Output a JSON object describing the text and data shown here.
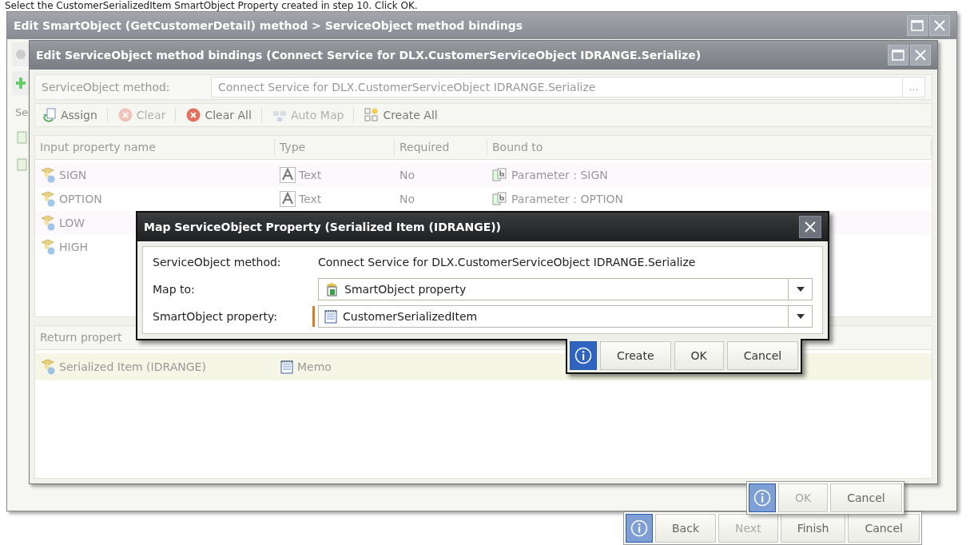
{
  "instruction": "Select the CustomerSerializedItem SmartObject Property created in step 10. Click OK.",
  "outer_window": {
    "title": "Edit SmartObject (GetCustomerDetail) method > ServiceObject method bindings",
    "side_label": "Se",
    "footer_buttons": [
      {
        "label": "Back",
        "disabled": false
      },
      {
        "label": "Next",
        "disabled": true
      },
      {
        "label": "Finish",
        "disabled": false
      },
      {
        "label": "Cancel",
        "disabled": false
      }
    ]
  },
  "bindings_window": {
    "title": "Edit ServiceObject method bindings (Connect Service for DLX.CustomerServiceObject IDRANGE.Serialize)",
    "method_label": "ServiceObject method:",
    "method_value": "Connect Service for DLX.CustomerServiceObject IDRANGE.Serialize",
    "browse_label": "...",
    "toolbar": [
      {
        "label": "Assign",
        "kind": "assign",
        "disabled": false
      },
      {
        "label": "Clear",
        "kind": "clear",
        "disabled": true
      },
      {
        "label": "Clear All",
        "kind": "clear",
        "disabled": false
      },
      {
        "label": "Auto Map",
        "kind": "automap",
        "disabled": true
      },
      {
        "label": "Create All",
        "kind": "create",
        "disabled": false
      }
    ],
    "input_columns": [
      "Input property name",
      "Type",
      "Required",
      "Bound to"
    ],
    "input_rows": [
      {
        "name": "SIGN",
        "type": "Text",
        "required": "No",
        "bound_to": "Parameter : SIGN"
      },
      {
        "name": "OPTION",
        "type": "Text",
        "required": "No",
        "bound_to": "Parameter : OPTION"
      },
      {
        "name": "LOW"
      },
      {
        "name": "HIGH"
      }
    ],
    "return_header": "Return propert",
    "return_rows": [
      {
        "name": "Serialized Item (IDRANGE)",
        "type": "Memo"
      }
    ],
    "footer_buttons": [
      {
        "label": "OK",
        "disabled": true
      },
      {
        "label": "Cancel",
        "disabled": false
      }
    ]
  },
  "map_dialog": {
    "title": "Map ServiceObject Property (Serialized Item (IDRANGE))",
    "fields": [
      {
        "label": "ServiceObject method:",
        "value": "Connect Service for DLX.CustomerServiceObject IDRANGE.Serialize",
        "kind": "text",
        "required": false
      },
      {
        "label": "Map to:",
        "value": "SmartObject property",
        "kind": "dropdown",
        "required": false
      },
      {
        "label": "SmartObject property:",
        "value": "CustomerSerializedItem",
        "kind": "dropdown",
        "required": true
      }
    ],
    "buttons": [
      {
        "label": "Create"
      },
      {
        "label": "OK"
      },
      {
        "label": "Cancel"
      }
    ]
  }
}
